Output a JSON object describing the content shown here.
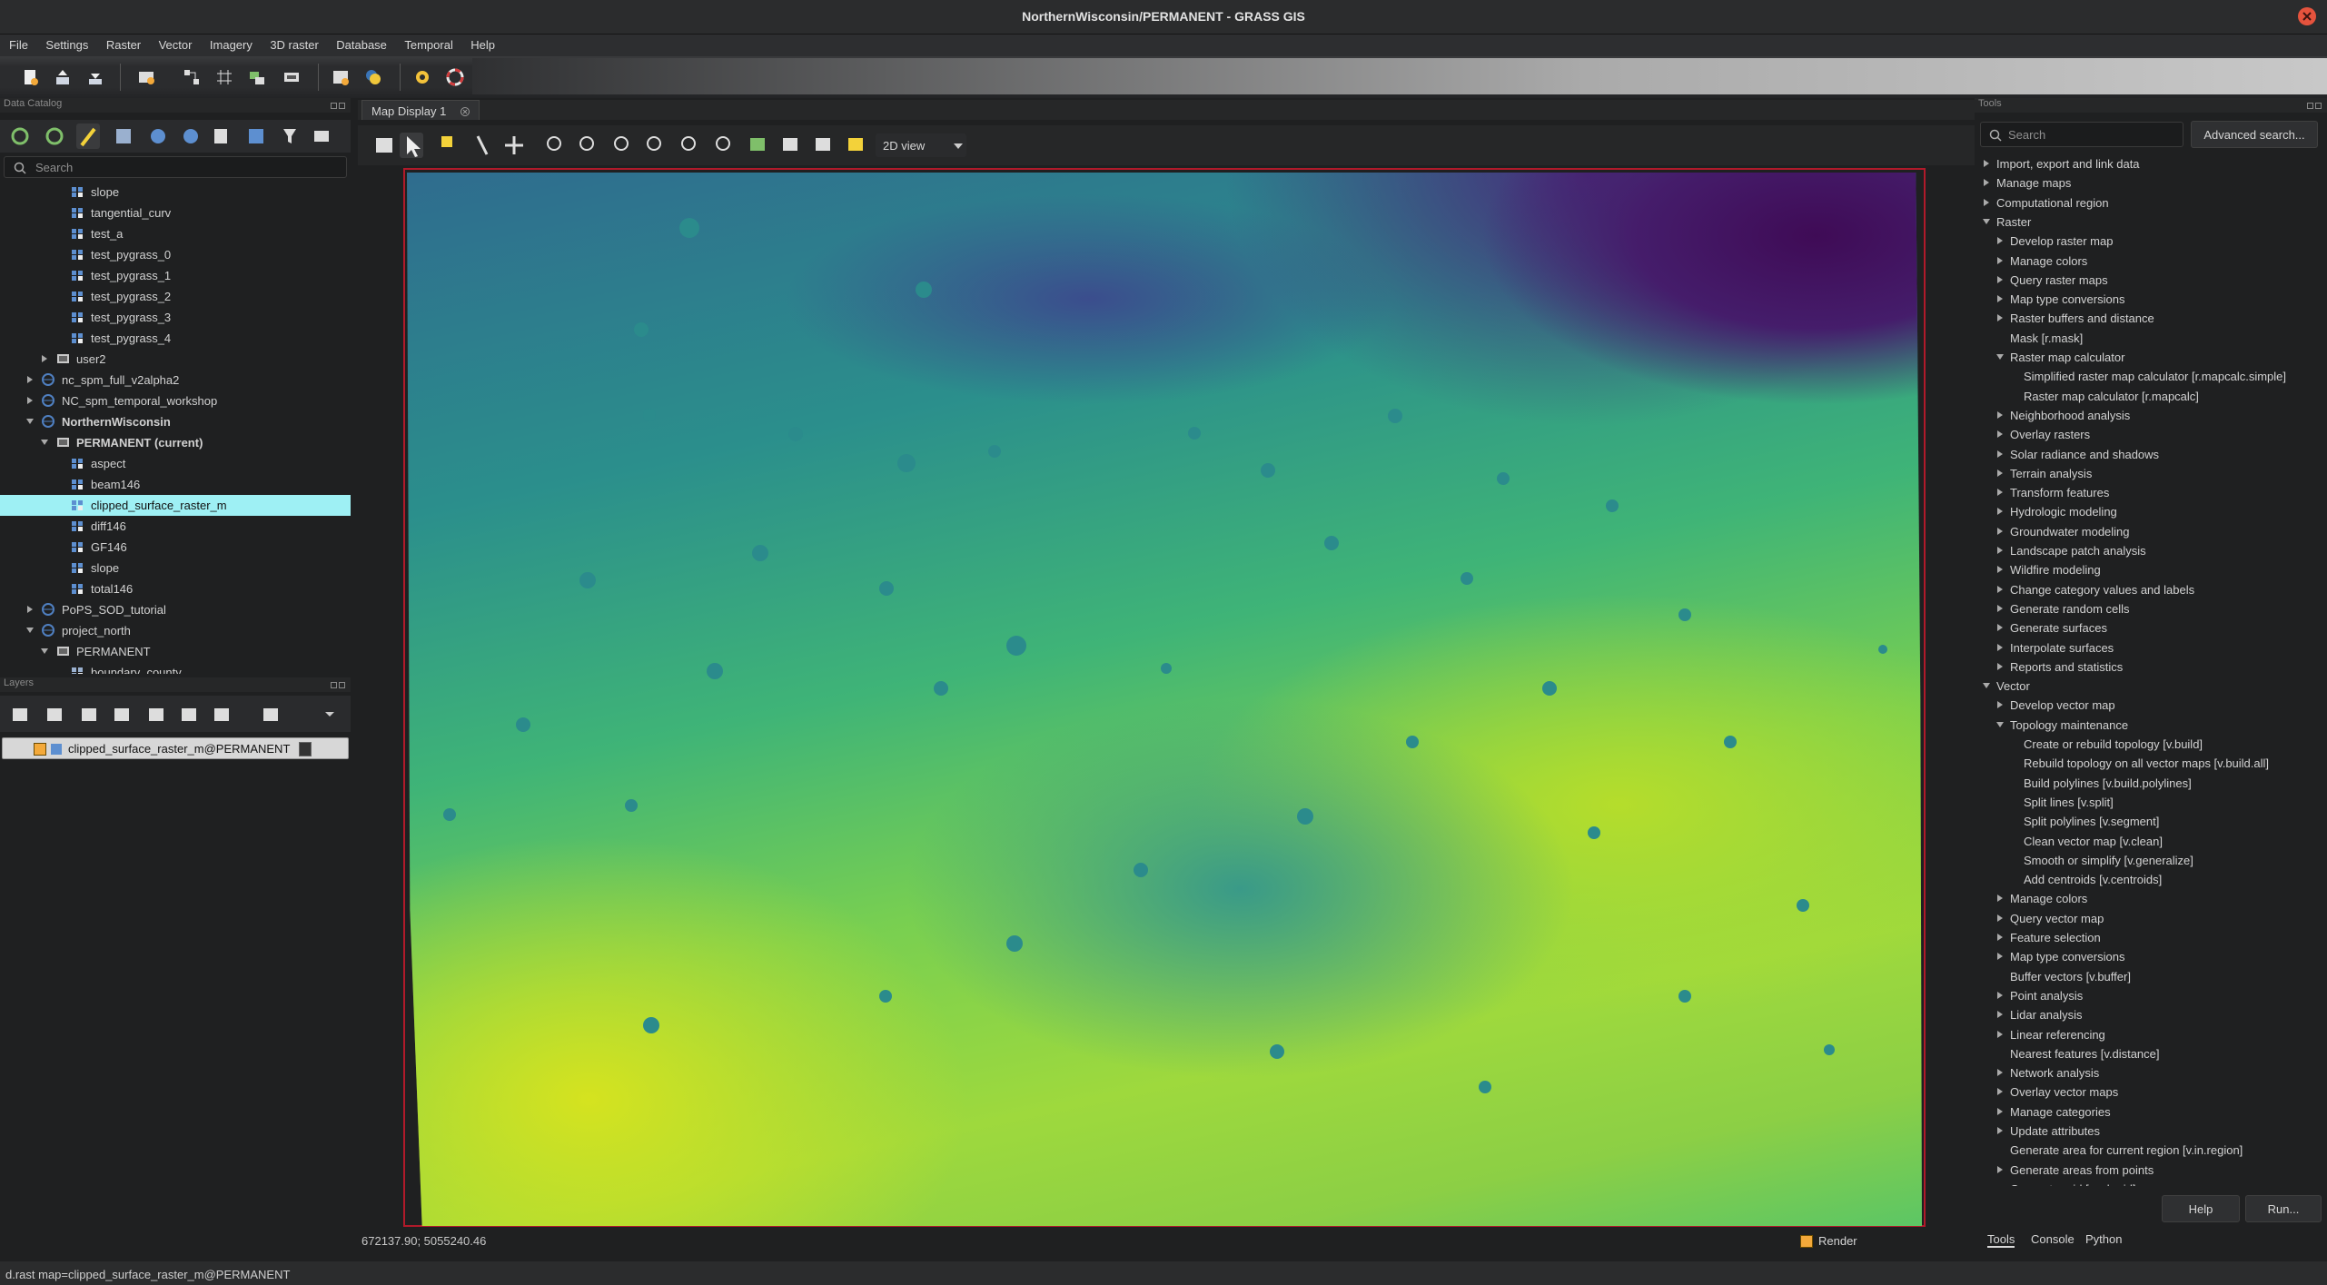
{
  "window": {
    "title": "NorthernWisconsin/PERMANENT - GRASS GIS"
  },
  "menu": [
    "File",
    "Settings",
    "Raster",
    "Vector",
    "Imagery",
    "3D raster",
    "Database",
    "Temporal",
    "Help"
  ],
  "catalog": {
    "title": "Data Catalog",
    "search_placeholder": "Search",
    "items": [
      {
        "label": "slope",
        "depth": 3,
        "kind": "raster",
        "arrow": ""
      },
      {
        "label": "tangential_curv",
        "depth": 3,
        "kind": "raster",
        "arrow": ""
      },
      {
        "label": "test_a",
        "depth": 3,
        "kind": "raster",
        "arrow": ""
      },
      {
        "label": "test_pygrass_0",
        "depth": 3,
        "kind": "raster",
        "arrow": ""
      },
      {
        "label": "test_pygrass_1",
        "depth": 3,
        "kind": "raster",
        "arrow": ""
      },
      {
        "label": "test_pygrass_2",
        "depth": 3,
        "kind": "raster",
        "arrow": ""
      },
      {
        "label": "test_pygrass_3",
        "depth": 3,
        "kind": "raster",
        "arrow": ""
      },
      {
        "label": "test_pygrass_4",
        "depth": 3,
        "kind": "raster",
        "arrow": ""
      },
      {
        "label": "user2",
        "depth": 2,
        "kind": "mapset",
        "arrow": "right"
      },
      {
        "label": "nc_spm_full_v2alpha2",
        "depth": 1,
        "kind": "location",
        "arrow": "right"
      },
      {
        "label": "NC_spm_temporal_workshop",
        "depth": 1,
        "kind": "location",
        "arrow": "right"
      },
      {
        "label": "NorthernWisconsin",
        "depth": 1,
        "kind": "location",
        "arrow": "down",
        "bold": true
      },
      {
        "label": "PERMANENT (current)",
        "depth": 2,
        "kind": "mapset",
        "arrow": "down",
        "bold": true
      },
      {
        "label": "aspect",
        "depth": 3,
        "kind": "raster",
        "arrow": ""
      },
      {
        "label": "beam146",
        "depth": 3,
        "kind": "raster",
        "arrow": ""
      },
      {
        "label": "clipped_surface_raster_m",
        "depth": 3,
        "kind": "raster",
        "arrow": "",
        "selected": true
      },
      {
        "label": "diff146",
        "depth": 3,
        "kind": "raster",
        "arrow": ""
      },
      {
        "label": "GF146",
        "depth": 3,
        "kind": "raster",
        "arrow": ""
      },
      {
        "label": "slope",
        "depth": 3,
        "kind": "raster",
        "arrow": ""
      },
      {
        "label": "total146",
        "depth": 3,
        "kind": "raster",
        "arrow": ""
      },
      {
        "label": "PoPS_SOD_tutorial",
        "depth": 1,
        "kind": "location",
        "arrow": "right"
      },
      {
        "label": "project_north",
        "depth": 1,
        "kind": "location",
        "arrow": "down"
      },
      {
        "label": "PERMANENT",
        "depth": 2,
        "kind": "mapset",
        "arrow": "down"
      },
      {
        "label": "boundary_county",
        "depth": 3,
        "kind": "vector",
        "arrow": ""
      }
    ]
  },
  "layers": {
    "title": "Layers",
    "items": [
      {
        "label": "clipped_surface_raster_m@PERMANENT",
        "checked": true
      }
    ]
  },
  "map": {
    "tab_label": "Map Display 1",
    "view_mode": "2D view",
    "coords": "672137.90; 5055240.46",
    "render_label": "Render"
  },
  "tools": {
    "title": "Tools",
    "search_placeholder": "Search",
    "advanced_label": "Advanced search...",
    "help_label": "Help",
    "run_label": "Run...",
    "tabs": [
      "Tools",
      "Console",
      "Python"
    ],
    "items": [
      {
        "label": "Import, export and link data",
        "depth": 0,
        "arrow": "right"
      },
      {
        "label": "Manage maps",
        "depth": 0,
        "arrow": "right"
      },
      {
        "label": "Computational region",
        "depth": 0,
        "arrow": "right"
      },
      {
        "label": "Raster",
        "depth": 0,
        "arrow": "down"
      },
      {
        "label": "Develop raster map",
        "depth": 1,
        "arrow": "right"
      },
      {
        "label": "Manage colors",
        "depth": 1,
        "arrow": "right"
      },
      {
        "label": "Query raster maps",
        "depth": 1,
        "arrow": "right"
      },
      {
        "label": "Map type conversions",
        "depth": 1,
        "arrow": "right"
      },
      {
        "label": "Raster buffers and distance",
        "depth": 1,
        "arrow": "right"
      },
      {
        "label": "Mask   [r.mask]",
        "depth": 1,
        "arrow": ""
      },
      {
        "label": "Raster map calculator",
        "depth": 1,
        "arrow": "down"
      },
      {
        "label": "Simplified raster map calculator   [r.mapcalc.simple]",
        "depth": 2,
        "arrow": ""
      },
      {
        "label": "Raster map calculator   [r.mapcalc]",
        "depth": 2,
        "arrow": ""
      },
      {
        "label": "Neighborhood analysis",
        "depth": 1,
        "arrow": "right"
      },
      {
        "label": "Overlay rasters",
        "depth": 1,
        "arrow": "right"
      },
      {
        "label": "Solar radiance and shadows",
        "depth": 1,
        "arrow": "right"
      },
      {
        "label": "Terrain analysis",
        "depth": 1,
        "arrow": "right"
      },
      {
        "label": "Transform features",
        "depth": 1,
        "arrow": "right"
      },
      {
        "label": "Hydrologic modeling",
        "depth": 1,
        "arrow": "right"
      },
      {
        "label": "Groundwater modeling",
        "depth": 1,
        "arrow": "right"
      },
      {
        "label": "Landscape patch analysis",
        "depth": 1,
        "arrow": "right"
      },
      {
        "label": "Wildfire modeling",
        "depth": 1,
        "arrow": "right"
      },
      {
        "label": "Change category values and labels",
        "depth": 1,
        "arrow": "right"
      },
      {
        "label": "Generate random cells",
        "depth": 1,
        "arrow": "right"
      },
      {
        "label": "Generate surfaces",
        "depth": 1,
        "arrow": "right"
      },
      {
        "label": "Interpolate surfaces",
        "depth": 1,
        "arrow": "right"
      },
      {
        "label": "Reports and statistics",
        "depth": 1,
        "arrow": "right"
      },
      {
        "label": "Vector",
        "depth": 0,
        "arrow": "down"
      },
      {
        "label": "Develop vector map",
        "depth": 1,
        "arrow": "right"
      },
      {
        "label": "Topology maintenance",
        "depth": 1,
        "arrow": "down"
      },
      {
        "label": "Create or rebuild topology   [v.build]",
        "depth": 2,
        "arrow": ""
      },
      {
        "label": "Rebuild topology on all vector maps   [v.build.all]",
        "depth": 2,
        "arrow": ""
      },
      {
        "label": "Build polylines   [v.build.polylines]",
        "depth": 2,
        "arrow": ""
      },
      {
        "label": "Split lines   [v.split]",
        "depth": 2,
        "arrow": ""
      },
      {
        "label": "Split polylines   [v.segment]",
        "depth": 2,
        "arrow": ""
      },
      {
        "label": "Clean vector map   [v.clean]",
        "depth": 2,
        "arrow": ""
      },
      {
        "label": "Smooth or simplify   [v.generalize]",
        "depth": 2,
        "arrow": ""
      },
      {
        "label": "Add centroids   [v.centroids]",
        "depth": 2,
        "arrow": ""
      },
      {
        "label": "Manage colors",
        "depth": 1,
        "arrow": "right"
      },
      {
        "label": "Query vector map",
        "depth": 1,
        "arrow": "right"
      },
      {
        "label": "Feature selection",
        "depth": 1,
        "arrow": "right"
      },
      {
        "label": "Map type conversions",
        "depth": 1,
        "arrow": "right"
      },
      {
        "label": "Buffer vectors   [v.buffer]",
        "depth": 1,
        "arrow": ""
      },
      {
        "label": "Point analysis",
        "depth": 1,
        "arrow": "right"
      },
      {
        "label": "Lidar analysis",
        "depth": 1,
        "arrow": "right"
      },
      {
        "label": "Linear referencing",
        "depth": 1,
        "arrow": "right"
      },
      {
        "label": "Nearest features   [v.distance]",
        "depth": 1,
        "arrow": ""
      },
      {
        "label": "Network analysis",
        "depth": 1,
        "arrow": "right"
      },
      {
        "label": "Overlay vector maps",
        "depth": 1,
        "arrow": "right"
      },
      {
        "label": "Manage categories",
        "depth": 1,
        "arrow": "right"
      },
      {
        "label": "Update attributes",
        "depth": 1,
        "arrow": "right"
      },
      {
        "label": "Generate area for current region   [v.in.region]",
        "depth": 1,
        "arrow": ""
      },
      {
        "label": "Generate areas from points",
        "depth": 1,
        "arrow": "right"
      },
      {
        "label": "Generate grid   [v.mkgrid]",
        "depth": 1,
        "arrow": ""
      }
    ]
  },
  "statusbar": {
    "text": "d.rast map=clipped_surface_raster_m@PERMANENT"
  },
  "colors": {
    "selection": "#9ef0f4",
    "accent": "#f3a93a",
    "frame": "#b01a2a"
  }
}
